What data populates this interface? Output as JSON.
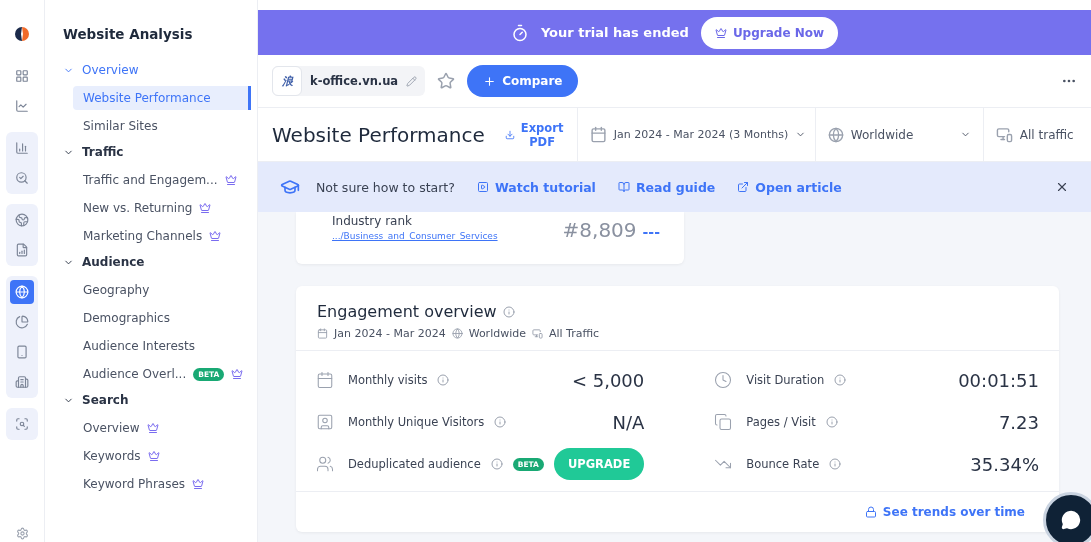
{
  "sidebar": {
    "title": "Website Analysis",
    "sections": [
      {
        "label": "Overview",
        "expanded": true,
        "selected": true,
        "children": [
          {
            "label": "Website Performance",
            "selected": true,
            "premium": false
          },
          {
            "label": "Similar Sites",
            "selected": false,
            "premium": false
          }
        ]
      },
      {
        "label": "Traffic",
        "expanded": true,
        "selected": false,
        "children": [
          {
            "label": "Traffic and Engagem...",
            "selected": false,
            "premium": true
          },
          {
            "label": "New vs. Returning",
            "selected": false,
            "premium": true
          },
          {
            "label": "Marketing Channels",
            "selected": false,
            "premium": true
          }
        ]
      },
      {
        "label": "Audience",
        "expanded": true,
        "selected": false,
        "children": [
          {
            "label": "Geography",
            "selected": false,
            "premium": false
          },
          {
            "label": "Demographics",
            "selected": false,
            "premium": false
          },
          {
            "label": "Audience Interests",
            "selected": false,
            "premium": false
          },
          {
            "label": "Audience Overl...",
            "selected": false,
            "premium": true,
            "badge": "BETA"
          }
        ]
      },
      {
        "label": "Search",
        "expanded": true,
        "selected": false,
        "children": [
          {
            "label": "Overview",
            "selected": false,
            "premium": true
          },
          {
            "label": "Keywords",
            "selected": false,
            "premium": true
          },
          {
            "label": "Keyword Phrases",
            "selected": false,
            "premium": true
          }
        ]
      }
    ]
  },
  "rail": {
    "groups": [
      [
        {
          "kind": "grid",
          "selected": false
        },
        {
          "kind": "trend",
          "selected": false
        }
      ],
      [
        {
          "kind": "bars",
          "selected": false
        },
        {
          "kind": "search",
          "selected": false
        }
      ],
      [
        {
          "kind": "globe-trend",
          "selected": false
        },
        {
          "kind": "doc-trend",
          "selected": false
        }
      ],
      [
        {
          "kind": "globe",
          "selected": true
        },
        {
          "kind": "pie",
          "selected": false
        },
        {
          "kind": "phone",
          "selected": false
        },
        {
          "kind": "building",
          "selected": false
        }
      ],
      [
        {
          "kind": "list-search",
          "selected": false
        }
      ]
    ]
  },
  "banner": {
    "text": "Your trial has ended",
    "button": "Upgrade Now"
  },
  "site": {
    "domain": "k-office.vn.ua",
    "favicon": "浪",
    "compare": "Compare"
  },
  "header": {
    "title": "Website Performance",
    "export": "Export PDF",
    "date_range": "Jan 2024 - Mar 2024 (3 Months)",
    "region": "Worldwide",
    "traffic": "All traffic"
  },
  "hint": {
    "text": "Not sure how to start?",
    "links": [
      {
        "kind": "video",
        "label": "Watch tutorial"
      },
      {
        "kind": "book",
        "label": "Read guide"
      },
      {
        "kind": "external",
        "label": "Open article"
      }
    ]
  },
  "rank_card": {
    "label": "Industry rank",
    "category": ".../Business_and_Consumer_Services",
    "value": "#8,809",
    "change": "---"
  },
  "engagement": {
    "title": "Engagement overview",
    "date": "Jan 2024 - Mar 2024",
    "region": "Worldwide",
    "traffic": "All Traffic",
    "metrics": [
      {
        "label": "Monthly visits",
        "kind": "value",
        "value": "< 5,000"
      },
      {
        "label": "Visit Duration",
        "kind": "value",
        "value": "00:01:51"
      },
      {
        "label": "Monthly Unique Visitors",
        "kind": "value",
        "value": "N/A"
      },
      {
        "label": "Pages / Visit",
        "kind": "value",
        "value": "7.23"
      },
      {
        "label": "Deduplicated audience",
        "badge": "BETA",
        "kind": "upgrade",
        "value": "UPGRADE"
      },
      {
        "label": "Bounce Rate",
        "kind": "value",
        "value": "35.34%"
      }
    ],
    "footer_link": "See trends over time"
  }
}
